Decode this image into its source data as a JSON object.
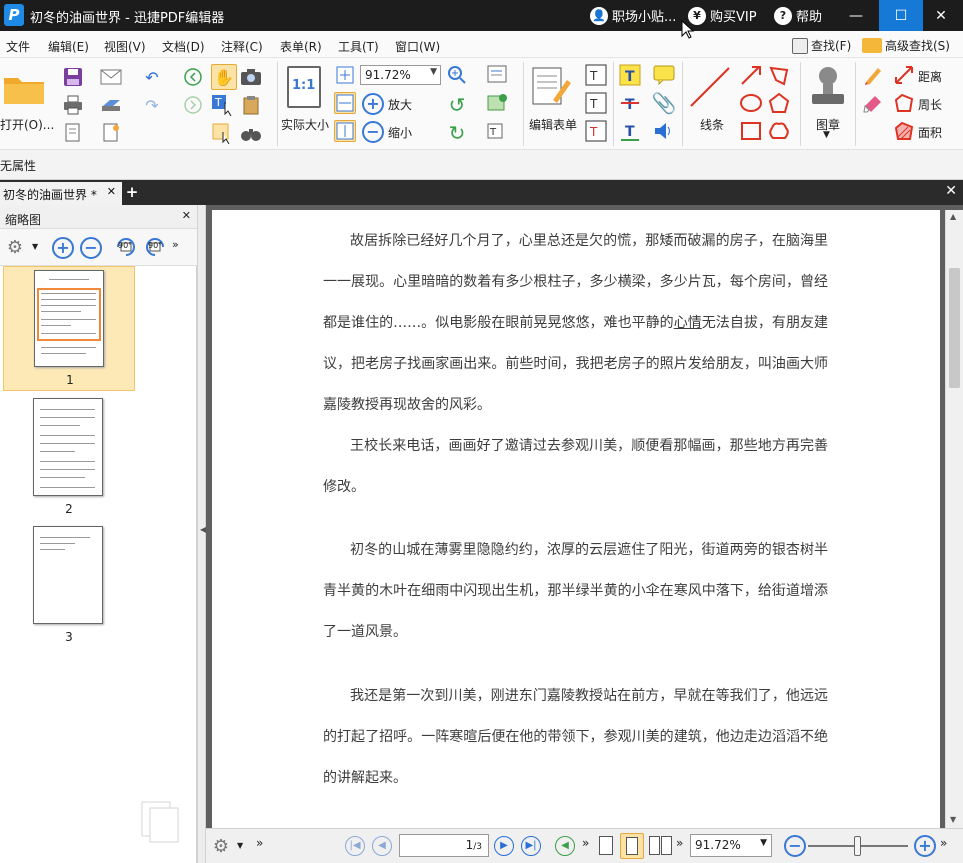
{
  "window": {
    "title": "初冬的油画世界 - 迅捷PDF编辑器",
    "logo_letter": "P",
    "right_items": [
      "职场小贴...",
      "购买VIP",
      "帮助"
    ],
    "controls": [
      "—",
      "☐",
      "✕"
    ]
  },
  "menubar": {
    "items": [
      "文件",
      "编辑(E)",
      "视图(V)",
      "文档(D)",
      "注释(C)",
      "表单(R)",
      "工具(T)",
      "窗口(W)"
    ],
    "find": "查找(F)",
    "advanced_find": "高级查找(S)"
  },
  "toolbar": {
    "open": "打开(O)...",
    "actual_size": "实际大小",
    "actual_size_icon": "1:1",
    "zoom_value": "91.72%",
    "zoom_in": "放大",
    "zoom_out": "缩小",
    "edit_form": "编辑表单",
    "lines": "线条",
    "stamp": "图章",
    "distance": "距离",
    "perimeter": "周长",
    "area": "面积"
  },
  "attrbar": {
    "label": "无属性"
  },
  "doctabs": {
    "active_tab": "初冬的油画世界 *"
  },
  "sidebar": {
    "title": "缩略图",
    "rotate_left": "90°",
    "rotate_right": "90°",
    "pages": [
      "1",
      "2",
      "3"
    ]
  },
  "document": {
    "paragraphs": [
      {
        "before": "故居拆除已经好几个月了，心里总还是欠的慌，那矮而破漏的房子，在脑海里一一展现。心里暗暗的数着有多少根柱子，多少横梁，多少片瓦，每个房间，曾经都是谁住的……。似电影般在眼前晃晃悠悠，难也平静的",
        "underlined": "心情",
        "after": "无法自拔，有朋友建议，把老房子找画家画出来。前些时间，我把老房子的照片发给朋友，叫油画大师嘉陵教授再现故舍的风彩。"
      },
      {
        "text": "王校长来电话，画画好了邀请过去参观川美，顺便看那幅画，那些地方再完善修改。"
      },
      {
        "text": "初冬的山城在薄雾里隐隐约约，浓厚的云层遮住了阳光，街道两旁的银杏树半青半黄的木叶在细雨中闪现出生机，那半绿半黄的小伞在寒风中落下，给街道增添了一道风景。"
      },
      {
        "text": "我还是第一次到川美，刚进东门嘉陵教授站在前方，早就在等我们了，他远远的打起了招呼。一阵寒暄后便在他的带领下，参观川美的建筑，他边走边滔滔不绝的讲解起来。"
      }
    ]
  },
  "bottombar": {
    "page_current": "1",
    "page_total": "/3",
    "zoom_value": "91.72%"
  },
  "colors": {
    "titlebar_bg": "#1c1c1c",
    "accent_blue": "#1679d6",
    "selected_thumb": "#fde9b6",
    "doc_bg": "#5f5f5f"
  }
}
